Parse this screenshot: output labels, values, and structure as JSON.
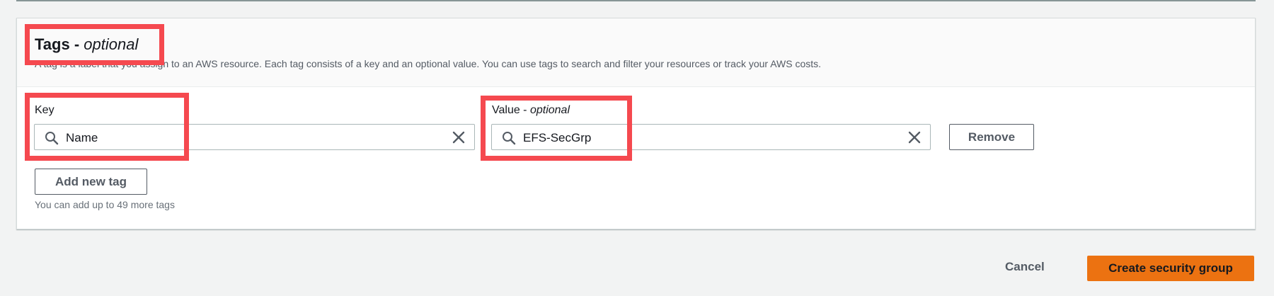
{
  "tags_section": {
    "title": "Tags - ",
    "title_optional": "optional",
    "description": "A tag is a label that you assign to an AWS resource. Each tag consists of a key and an optional value. You can use tags to search and filter your resources or track your AWS costs.",
    "key_label": "Key",
    "value_label": "Value - ",
    "value_label_optional": "optional",
    "key_value": "Name",
    "value_value": "EFS-SecGrp",
    "remove_label": "Remove",
    "add_tag_label": "Add new tag",
    "hint": "You can add up to 49 more tags"
  },
  "footer": {
    "cancel_label": "Cancel",
    "create_label": "Create security group"
  },
  "colors": {
    "primary": "#ec7211",
    "highlight": "#f5494f"
  },
  "icons": {
    "search": "search-icon",
    "clear": "close-icon"
  }
}
